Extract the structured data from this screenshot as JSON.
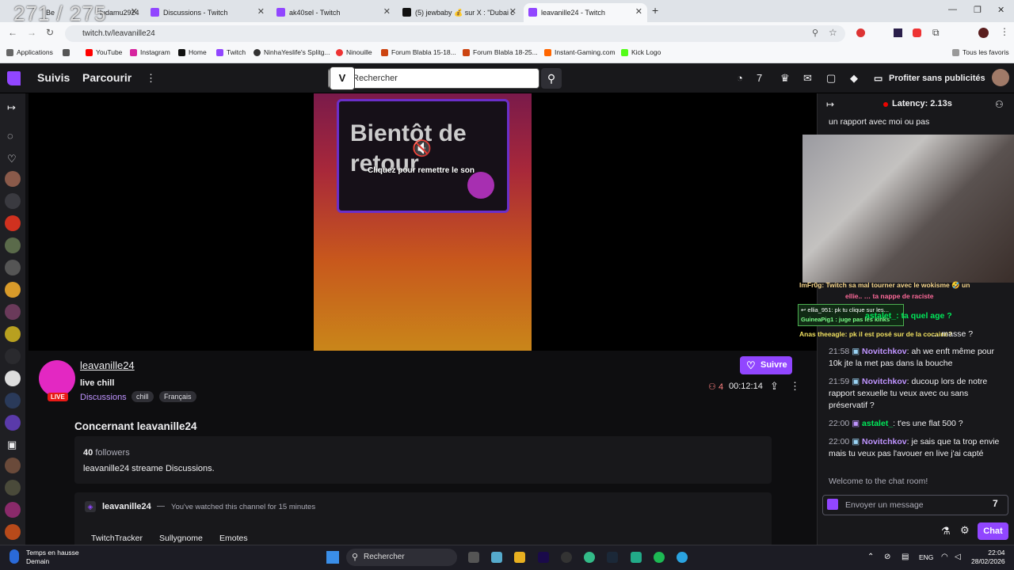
{
  "overlay_counter": "271 / 275",
  "browser": {
    "tabs": [
      {
        "title": "Be"
      },
      {
        "title": "ludamu2924"
      },
      {
        "title": "Discussions - Twitch"
      },
      {
        "title": "ak40sel - Twitch"
      },
      {
        "title": "(5) jewbaby 💰 sur X : \"Dubai c"
      },
      {
        "title": "leavanille24 - Twitch"
      }
    ],
    "url": "twitch.tv/leavanille24",
    "bookmarks": [
      "Applications",
      "YouTube",
      "Instagram",
      "Home",
      "Twitch",
      "NinhaYeslife's Splitg...",
      "Ninouille",
      "Forum Blabla 15-18...",
      "Forum Blabla 18-25...",
      "Instant-Gaming.com",
      "Kick Logo"
    ],
    "all_bookmarks": "Tous les favoris"
  },
  "twitch": {
    "nav": {
      "following": "Suivis",
      "browse": "Parcourir",
      "search_placeholder": "Rechercher",
      "adfree": "Profiter sans publicités"
    },
    "player": {
      "soon_text": "Bientôt de retour",
      "unmute": "Cliquez pour remettre le son"
    },
    "channel": {
      "name": "leavanille24",
      "live": "LIVE",
      "title": "live chill",
      "category": "Discussions",
      "tags": [
        "chill",
        "Français"
      ],
      "follow": "Suivre",
      "viewers": "4",
      "uptime": "00:12:14"
    },
    "about": {
      "heading": "Concernant leavanille24",
      "followers_count": "40",
      "followers_label": "followers",
      "description": "leavanille24 streame Discussions."
    },
    "panel": {
      "name": "leavanille24",
      "separator": "—",
      "watched": "You've watched this channel for 15 minutes",
      "links": [
        "TwitchTracker",
        "Sullygnome",
        "Emotes"
      ]
    },
    "chat": {
      "latency": "Latency: 2.13s",
      "top_fragment": "un rapport avec moi ou pas",
      "overlay_lines": [
        "ImFr0g: Twitch sa mal tourner avec le wokisme 🤣 un",
        "ellie.. … ta nappe de raciste",
        "↩ ellia_951: pk tu clique sur les...",
        "GuineaPig1 : juge pas les kinks",
        "Anas theeagle: pk il est posé sur de la cocaine?",
        "astalet_: ta quel age ?",
        "… masse ?"
      ],
      "messages": [
        {
          "time": "21:58",
          "user": "Novitchkov",
          "color": "#bf94ff",
          "text": ": ah we enft même pour 10k jte la met pas dans la bouche"
        },
        {
          "time": "21:59",
          "user": "Novitchkov",
          "color": "#bf94ff",
          "text": ": ducoup lors de notre rapport sexuelle tu veux avec ou sans préservatif ?"
        },
        {
          "time": "22:00",
          "user": "astalet_",
          "color": "#00e85a",
          "text": ": t'es une flat 500 ?"
        },
        {
          "time": "22:00",
          "user": "Novitchkov",
          "color": "#bf94ff",
          "text": ": je sais que ta trop envie mais tu veux pas l'avouer en live j'ai capté"
        }
      ],
      "welcome": "Welcome to the chat room!",
      "input_placeholder": "Envoyer un message",
      "send": "Chat"
    }
  },
  "taskbar": {
    "weather_title": "Temps en hausse",
    "weather_sub": "Demain",
    "search": "Rechercher",
    "lang": "ENG",
    "time": "22:04",
    "date": "28/02/2026"
  }
}
